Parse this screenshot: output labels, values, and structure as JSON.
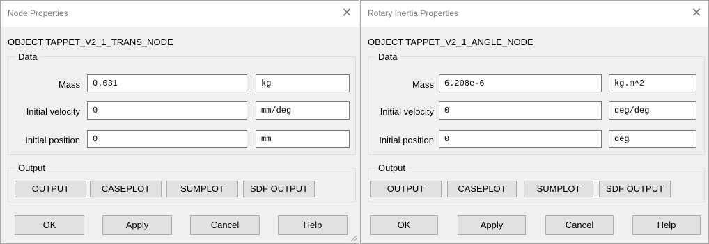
{
  "windows": [
    {
      "title": "Node Properties",
      "object_label": "OBJECT TAPPET_V2_1_TRANS_NODE",
      "data_group": "Data",
      "rows": [
        {
          "label": "Mass",
          "value": "0.031",
          "unit": "kg"
        },
        {
          "label": "Initial velocity",
          "value": "0",
          "unit": "mm/deg"
        },
        {
          "label": "Initial position",
          "value": "0",
          "unit": "mm"
        }
      ],
      "output_group": "Output",
      "output_buttons": [
        "OUTPUT",
        "CASEPLOT",
        "SUMPLOT",
        "SDF OUTPUT"
      ],
      "dialog_buttons": [
        "OK",
        "Apply",
        "Cancel",
        "Help"
      ]
    },
    {
      "title": "Rotary Inertia Properties",
      "object_label": "OBJECT TAPPET_V2_1_ANGLE_NODE",
      "data_group": "Data",
      "rows": [
        {
          "label": "Mass",
          "value": "6.208e-6",
          "unit": "kg.m^2"
        },
        {
          "label": "Initial velocity",
          "value": "0",
          "unit": "deg/deg"
        },
        {
          "label": "Initial position",
          "value": "0",
          "unit": "deg"
        }
      ],
      "output_group": "Output",
      "output_buttons": [
        "OUTPUT",
        "CASEPLOT",
        "SUMPLOT",
        "SDF OUTPUT"
      ],
      "dialog_buttons": [
        "OK",
        "Apply",
        "Cancel",
        "Help"
      ]
    }
  ]
}
